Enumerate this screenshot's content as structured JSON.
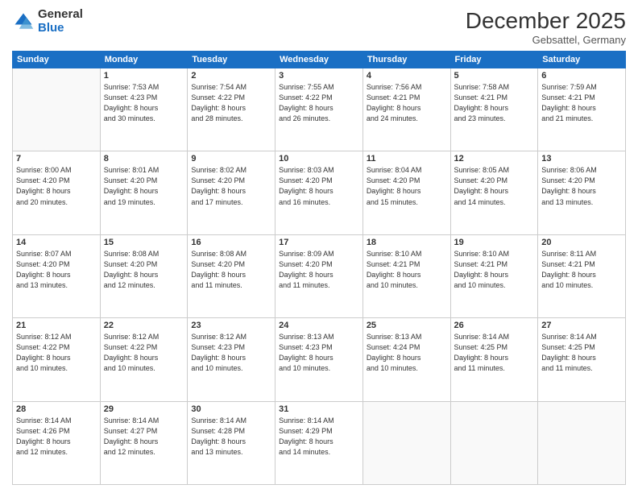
{
  "header": {
    "logo_general": "General",
    "logo_blue": "Blue",
    "title": "December 2025",
    "subtitle": "Gebsattel, Germany"
  },
  "days_header": [
    "Sunday",
    "Monday",
    "Tuesday",
    "Wednesday",
    "Thursday",
    "Friday",
    "Saturday"
  ],
  "weeks": [
    [
      {
        "num": "",
        "info": ""
      },
      {
        "num": "1",
        "info": "Sunrise: 7:53 AM\nSunset: 4:23 PM\nDaylight: 8 hours\nand 30 minutes."
      },
      {
        "num": "2",
        "info": "Sunrise: 7:54 AM\nSunset: 4:22 PM\nDaylight: 8 hours\nand 28 minutes."
      },
      {
        "num": "3",
        "info": "Sunrise: 7:55 AM\nSunset: 4:22 PM\nDaylight: 8 hours\nand 26 minutes."
      },
      {
        "num": "4",
        "info": "Sunrise: 7:56 AM\nSunset: 4:21 PM\nDaylight: 8 hours\nand 24 minutes."
      },
      {
        "num": "5",
        "info": "Sunrise: 7:58 AM\nSunset: 4:21 PM\nDaylight: 8 hours\nand 23 minutes."
      },
      {
        "num": "6",
        "info": "Sunrise: 7:59 AM\nSunset: 4:21 PM\nDaylight: 8 hours\nand 21 minutes."
      }
    ],
    [
      {
        "num": "7",
        "info": "Sunrise: 8:00 AM\nSunset: 4:20 PM\nDaylight: 8 hours\nand 20 minutes."
      },
      {
        "num": "8",
        "info": "Sunrise: 8:01 AM\nSunset: 4:20 PM\nDaylight: 8 hours\nand 19 minutes."
      },
      {
        "num": "9",
        "info": "Sunrise: 8:02 AM\nSunset: 4:20 PM\nDaylight: 8 hours\nand 17 minutes."
      },
      {
        "num": "10",
        "info": "Sunrise: 8:03 AM\nSunset: 4:20 PM\nDaylight: 8 hours\nand 16 minutes."
      },
      {
        "num": "11",
        "info": "Sunrise: 8:04 AM\nSunset: 4:20 PM\nDaylight: 8 hours\nand 15 minutes."
      },
      {
        "num": "12",
        "info": "Sunrise: 8:05 AM\nSunset: 4:20 PM\nDaylight: 8 hours\nand 14 minutes."
      },
      {
        "num": "13",
        "info": "Sunrise: 8:06 AM\nSunset: 4:20 PM\nDaylight: 8 hours\nand 13 minutes."
      }
    ],
    [
      {
        "num": "14",
        "info": "Sunrise: 8:07 AM\nSunset: 4:20 PM\nDaylight: 8 hours\nand 13 minutes."
      },
      {
        "num": "15",
        "info": "Sunrise: 8:08 AM\nSunset: 4:20 PM\nDaylight: 8 hours\nand 12 minutes."
      },
      {
        "num": "16",
        "info": "Sunrise: 8:08 AM\nSunset: 4:20 PM\nDaylight: 8 hours\nand 11 minutes."
      },
      {
        "num": "17",
        "info": "Sunrise: 8:09 AM\nSunset: 4:20 PM\nDaylight: 8 hours\nand 11 minutes."
      },
      {
        "num": "18",
        "info": "Sunrise: 8:10 AM\nSunset: 4:21 PM\nDaylight: 8 hours\nand 10 minutes."
      },
      {
        "num": "19",
        "info": "Sunrise: 8:10 AM\nSunset: 4:21 PM\nDaylight: 8 hours\nand 10 minutes."
      },
      {
        "num": "20",
        "info": "Sunrise: 8:11 AM\nSunset: 4:21 PM\nDaylight: 8 hours\nand 10 minutes."
      }
    ],
    [
      {
        "num": "21",
        "info": "Sunrise: 8:12 AM\nSunset: 4:22 PM\nDaylight: 8 hours\nand 10 minutes."
      },
      {
        "num": "22",
        "info": "Sunrise: 8:12 AM\nSunset: 4:22 PM\nDaylight: 8 hours\nand 10 minutes."
      },
      {
        "num": "23",
        "info": "Sunrise: 8:12 AM\nSunset: 4:23 PM\nDaylight: 8 hours\nand 10 minutes."
      },
      {
        "num": "24",
        "info": "Sunrise: 8:13 AM\nSunset: 4:23 PM\nDaylight: 8 hours\nand 10 minutes."
      },
      {
        "num": "25",
        "info": "Sunrise: 8:13 AM\nSunset: 4:24 PM\nDaylight: 8 hours\nand 10 minutes."
      },
      {
        "num": "26",
        "info": "Sunrise: 8:14 AM\nSunset: 4:25 PM\nDaylight: 8 hours\nand 11 minutes."
      },
      {
        "num": "27",
        "info": "Sunrise: 8:14 AM\nSunset: 4:25 PM\nDaylight: 8 hours\nand 11 minutes."
      }
    ],
    [
      {
        "num": "28",
        "info": "Sunrise: 8:14 AM\nSunset: 4:26 PM\nDaylight: 8 hours\nand 12 minutes."
      },
      {
        "num": "29",
        "info": "Sunrise: 8:14 AM\nSunset: 4:27 PM\nDaylight: 8 hours\nand 12 minutes."
      },
      {
        "num": "30",
        "info": "Sunrise: 8:14 AM\nSunset: 4:28 PM\nDaylight: 8 hours\nand 13 minutes."
      },
      {
        "num": "31",
        "info": "Sunrise: 8:14 AM\nSunset: 4:29 PM\nDaylight: 8 hours\nand 14 minutes."
      },
      {
        "num": "",
        "info": ""
      },
      {
        "num": "",
        "info": ""
      },
      {
        "num": "",
        "info": ""
      }
    ]
  ]
}
